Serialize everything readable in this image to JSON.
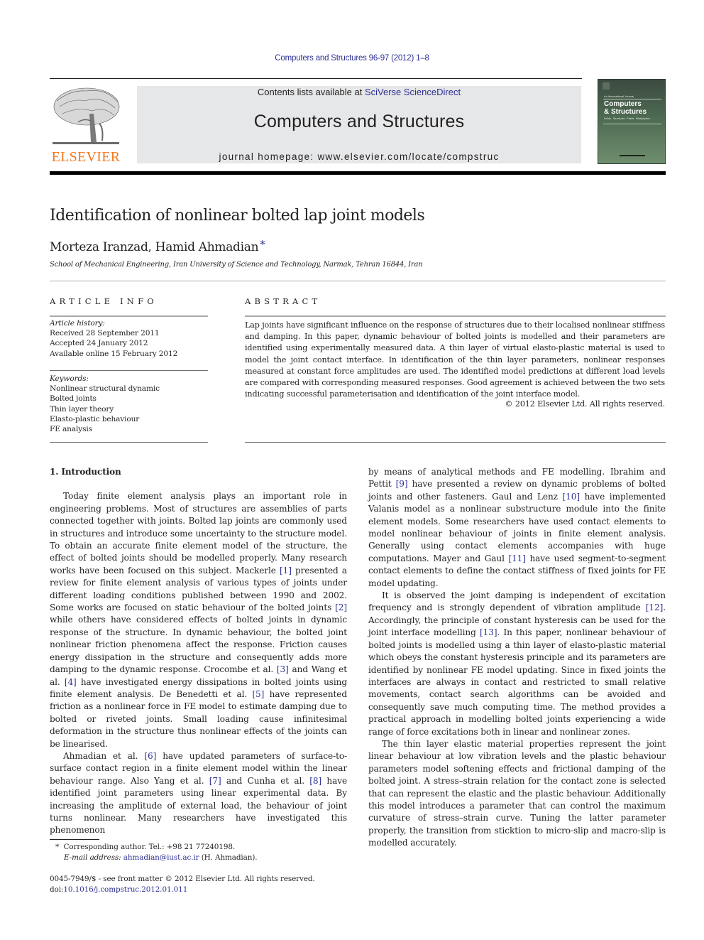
{
  "header": {
    "citation": "Computers and Structures 96-97 (2012) 1–8",
    "contents_prefix": "Contents lists available at ",
    "contents_link": "SciVerse ScienceDirect",
    "journal_title": "Computers and Structures",
    "homepage": "journal homepage: www.elsevier.com/locate/compstruc",
    "publisher_logo_text": "ELSEVIER",
    "cover": {
      "kicker": "An International Journal",
      "title_line1": "Computers",
      "title_line2": "& Structures",
      "subtitle": "Solids · Structures · Fluids · Multiphysics"
    },
    "colors": {
      "link": "#2e3192",
      "elsevier_orange": "#f47920",
      "banner_bg": "#e6e7e8"
    }
  },
  "article": {
    "title": "Identification of nonlinear bolted lap joint models",
    "authors": "Morteza Iranzad, Hamid Ahmadian",
    "author_mark": "*",
    "affiliation": "School of Mechanical Engineering, Iran University of Science and Technology, Narmak, Tehran 16844, Iran"
  },
  "article_info": {
    "heading": "ARTICLE INFO",
    "history_label": "Article history:",
    "history": [
      "Received 28 September 2011",
      "Accepted 24 January 2012",
      "Available online 15 February 2012"
    ],
    "keywords_label": "Keywords:",
    "keywords": [
      "Nonlinear structural dynamic",
      "Bolted joints",
      "Thin layer theory",
      "Elasto-plastic behaviour",
      "FE analysis"
    ]
  },
  "abstract": {
    "heading": "ABSTRACT",
    "text": "Lap joints have significant influence on the response of structures due to their localised nonlinear stiffness and damping. In this paper, dynamic behaviour of bolted joints is modelled and their parameters are identified using experimentally measured data. A thin layer of virtual elasto-plastic material is used to model the joint contact interface. In identification of the thin layer parameters, nonlinear responses measured at constant force amplitudes are used. The identified model predictions at different load levels are compared with corresponding measured responses. Good agreement is achieved between the two sets indicating successful parameterisation and identification of the joint interface model.",
    "copyright": "© 2012 Elsevier Ltd. All rights reserved."
  },
  "body": {
    "section1_heading": "1. Introduction",
    "left_p1": [
      "Today finite element analysis plays an important role in engineering problems. Most of structures are assemblies of parts connected together with joints. Bolted lap joints are commonly used in structures and introduce some uncertainty to the structure model. To obtain an accurate finite element model of the structure, the effect of bolted joints should be modelled properly. Many research works have been focused on this subject. Mackerle ",
      "[1]",
      " presented a review for finite element analysis of various types of joints under different loading conditions published between 1990 and 2002. Some works are focused on static behaviour of the bolted joints ",
      "[2]",
      " while others have considered effects of bolted joints in dynamic response of the structure. In dynamic behaviour, the bolted joint nonlinear friction phenomena affect the response. Friction causes energy dissipation in the structure and consequently adds more damping to the dynamic response. Crocombe et al. ",
      "[3]",
      " and Wang et al. ",
      "[4]",
      " have investigated energy dissipations in bolted joints using finite element analysis. De Benedetti et al. ",
      "[5]",
      " have represented friction as a nonlinear force in FE model to estimate damping due to bolted or riveted joints. Small loading cause infinitesimal deformation in the structure thus nonlinear effects of the joints can be linearised."
    ],
    "left_p2": [
      "Ahmadian et al. ",
      "[6]",
      " have updated parameters of surface-to-surface contact region in a finite element model within the linear behaviour range. Also Yang et al. ",
      "[7]",
      " and Cunha et al. ",
      "[8]",
      " have identified joint parameters using linear experimental data. By increasing the amplitude of external load, the behaviour of joint turns nonlinear. Many researchers have investigated this phenomenon"
    ],
    "right_p1": [
      "by means of analytical methods and FE modelling. Ibrahim and Pettit ",
      "[9]",
      " have presented a review on dynamic problems of bolted joints and other fasteners. Gaul and Lenz ",
      "[10]",
      " have implemented Valanis model as a nonlinear substructure module into the finite element models. Some researchers have used contact elements to model nonlinear behaviour of joints in finite element analysis. Generally using contact elements accompanies with huge computations. Mayer and Gaul ",
      "[11]",
      " have used segment-to-segment contact elements to define the contact stiffness of fixed joints for FE model updating."
    ],
    "right_p2": [
      "It is observed the joint damping is independent of excitation frequency and is strongly dependent of vibration amplitude ",
      "[12]",
      ". Accordingly, the principle of constant hysteresis can be used for the joint interface modelling ",
      "[13]",
      ". In this paper, nonlinear behaviour of bolted joints is modelled using a thin layer of elasto-plastic material which obeys the constant hysteresis principle and its parameters are identified by nonlinear FE model updating. Since in fixed joints the interfaces are always in contact and restricted to small relative movements, contact search algorithms can be avoided and consequently save much computing time. The method provides a practical approach in modelling bolted joints experiencing a wide range of force excitations both in linear and nonlinear zones."
    ],
    "right_p3": "The thin layer elastic material properties represent the joint linear behaviour at low vibration levels and the plastic behaviour parameters model softening effects and frictional damping of the bolted joint. A stress–strain relation for the contact zone is selected that can represent the elastic and the plastic behaviour. Additionally this model introduces a parameter that can control the maximum curvature of stress–strain curve. Tuning the latter parameter properly, the transition from sticktion to micro-slip and macro-slip is modelled accurately."
  },
  "footnote": {
    "mark": "*",
    "corresponding": "Corresponding author. Tel.: +98 21 77240198.",
    "email_label": "E-mail address:",
    "email": "ahmadian@iust.ac.ir",
    "email_suffix": " (H. Ahmadian)."
  },
  "meta": {
    "issn_line": "0045-7949/$ - see front matter © 2012 Elsevier Ltd. All rights reserved.",
    "doi_label": "doi:",
    "doi": "10.1016/j.compstruc.2012.01.011"
  }
}
